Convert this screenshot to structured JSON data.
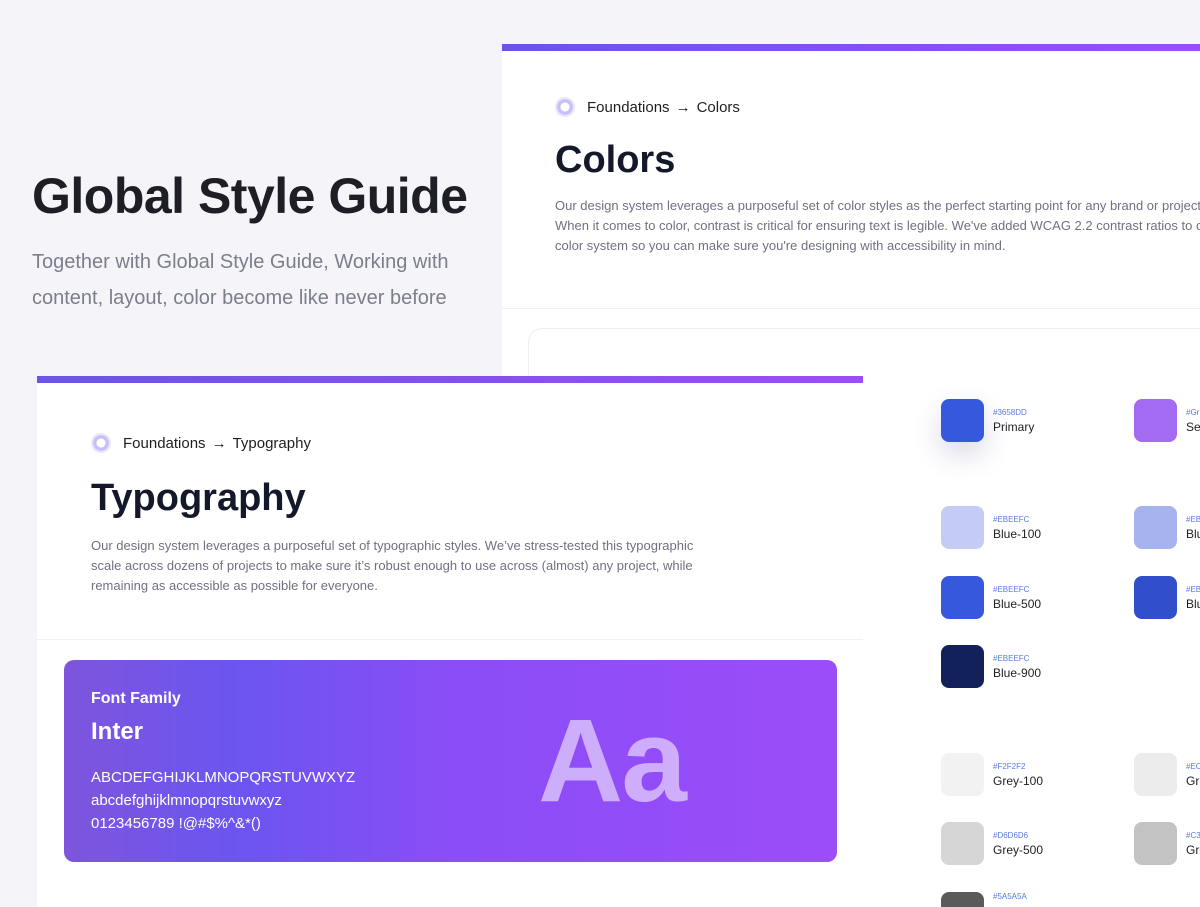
{
  "hero": {
    "title": "Global Style Guide",
    "subtitle_line1": "Together with Global Style Guide, Working with",
    "subtitle_line2": "content, layout, color become like never before"
  },
  "colors_page": {
    "breadcrumb_root": "Foundations",
    "breadcrumb_arrow": "→",
    "breadcrumb_current": "Colors",
    "title": "Colors",
    "description": "Our design system leverages a purposeful set of color styles as the perfect starting point for any brand or project. When it comes to color, contrast is critical for ensuring text is legible. We've added WCAG 2.2 contrast ratios to our color system so you can make sure you're designing with accessibility in mind.",
    "swatches": [
      {
        "hex": "#3658DD",
        "name": "Primary",
        "color": "#3658dd"
      },
      {
        "hex": "#Gr",
        "name": "Se",
        "color": "#a46cf3"
      },
      {
        "hex": "#EBEEFC",
        "name": "Blue-100",
        "color": "#c4ccf6"
      },
      {
        "hex": "#EB",
        "name": "Blu",
        "color": "#a6b3ef"
      },
      {
        "hex": "#EBEEFC",
        "name": "Blue-500",
        "color": "#3658dd"
      },
      {
        "hex": "#EB",
        "name": "Blu",
        "color": "#314fcb"
      },
      {
        "hex": "#EBEEFC",
        "name": "Blue-900",
        "color": "#13215a"
      },
      {
        "hex": "#F2F2F2",
        "name": "Grey-100",
        "color": "#f2f2f2"
      },
      {
        "hex": "#EC",
        "name": "Gre",
        "color": "#ececec"
      },
      {
        "hex": "#D6D6D6",
        "name": "Grey-500",
        "color": "#d6d6d6"
      },
      {
        "hex": "#C3",
        "name": "Gre",
        "color": "#c3c3c3"
      },
      {
        "hex": "#5A5A5A",
        "name": "",
        "color": "#5a5a5a"
      }
    ]
  },
  "typography_page": {
    "breadcrumb_root": "Foundations",
    "breadcrumb_arrow": "→",
    "breadcrumb_current": "Typography",
    "title": "Typography",
    "description_line1": "Our design system leverages a purposeful set of typographic styles. We’ve stress-tested this typographic",
    "description_line2": "scale across dozens of projects to make sure it’s robust enough to use across (almost) any project, while",
    "description_line3": "remaining as accessible as possible for everyone.",
    "font_card": {
      "label": "Font Family",
      "font_name": "Inter",
      "uppercase": "ABCDEFGHIJKLMNOPQRSTUVWXYZ",
      "lowercase": "abcdefghijklmnopqrstuvwxyz",
      "digits": "0123456789 !@#$%^&*()",
      "sample": "Aa"
    }
  },
  "colors": {
    "accent_start": "#6b54e8",
    "accent_end": "#9b4df8",
    "background": "#f4f4f9"
  }
}
